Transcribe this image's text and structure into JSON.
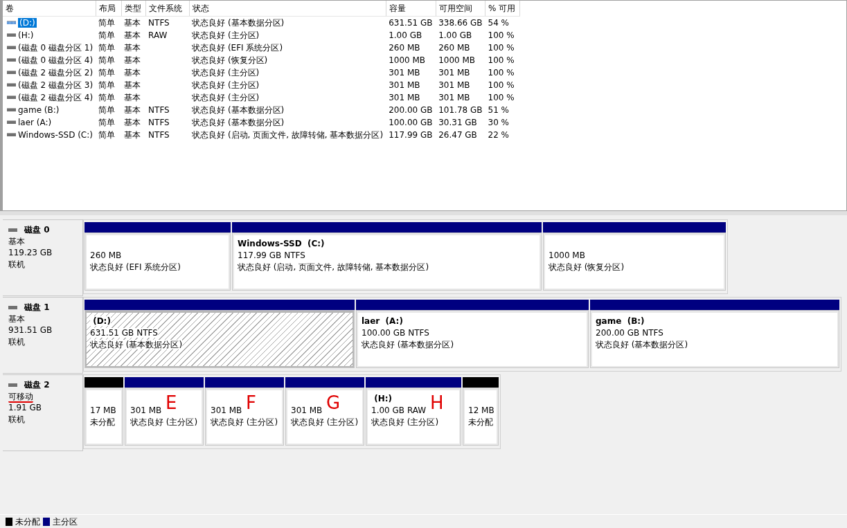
{
  "volume_table": {
    "columns": [
      "卷",
      "布局",
      "类型",
      "文件系统",
      "状态",
      "容量",
      "可用空间",
      "% 可用"
    ],
    "rows": [
      {
        "selected": true,
        "cells": [
          "(D:)",
          "简单",
          "基本",
          "NTFS",
          "状态良好 (基本数据分区)",
          "631.51 GB",
          "338.66 GB",
          "54 %"
        ]
      },
      {
        "selected": false,
        "cells": [
          "(H:)",
          "简单",
          "基本",
          "RAW",
          "状态良好 (主分区)",
          "1.00 GB",
          "1.00 GB",
          "100 %"
        ]
      },
      {
        "selected": false,
        "cells": [
          "(磁盘 0 磁盘分区 1)",
          "简单",
          "基本",
          "",
          "状态良好 (EFI 系统分区)",
          "260 MB",
          "260 MB",
          "100 %"
        ]
      },
      {
        "selected": false,
        "cells": [
          "(磁盘 0 磁盘分区 4)",
          "简单",
          "基本",
          "",
          "状态良好 (恢复分区)",
          "1000 MB",
          "1000 MB",
          "100 %"
        ]
      },
      {
        "selected": false,
        "cells": [
          "(磁盘 2 磁盘分区 2)",
          "简单",
          "基本",
          "",
          "状态良好 (主分区)",
          "301 MB",
          "301 MB",
          "100 %"
        ]
      },
      {
        "selected": false,
        "cells": [
          "(磁盘 2 磁盘分区 3)",
          "简单",
          "基本",
          "",
          "状态良好 (主分区)",
          "301 MB",
          "301 MB",
          "100 %"
        ]
      },
      {
        "selected": false,
        "cells": [
          "(磁盘 2 磁盘分区 4)",
          "简单",
          "基本",
          "",
          "状态良好 (主分区)",
          "301 MB",
          "301 MB",
          "100 %"
        ]
      },
      {
        "selected": false,
        "cells": [
          "game (B:)",
          "简单",
          "基本",
          "NTFS",
          "状态良好 (基本数据分区)",
          "200.00 GB",
          "101.78 GB",
          "51 %"
        ]
      },
      {
        "selected": false,
        "cells": [
          "laer (A:)",
          "简单",
          "基本",
          "NTFS",
          "状态良好 (基本数据分区)",
          "100.00 GB",
          "30.31 GB",
          "30 %"
        ]
      },
      {
        "selected": false,
        "cells": [
          "Windows-SSD (C:)",
          "简单",
          "基本",
          "NTFS",
          "状态良好 (启动, 页面文件, 故障转储, 基本数据分区)",
          "117.99 GB",
          "26.47 GB",
          "22 %"
        ]
      }
    ]
  },
  "disks": [
    {
      "name": "磁盘 0",
      "type": "基本",
      "size": "119.23 GB",
      "status": "联机",
      "type_underlined": false,
      "partitions": [
        {
          "kind": "primary",
          "selected": false,
          "size": "260 MB",
          "status": "状态良好 (EFI 系统分区)"
        },
        {
          "kind": "primary",
          "selected": false,
          "name": "Windows-SSD  (C:)",
          "size": "117.99 GB NTFS",
          "status": "状态良好 (启动, 页面文件, 故障转储, 基本数据分区)"
        },
        {
          "kind": "primary",
          "selected": false,
          "size": "1000 MB",
          "status": "状态良好 (恢复分区)"
        }
      ]
    },
    {
      "name": "磁盘 1",
      "type": "基本",
      "size": "931.51 GB",
      "status": "联机",
      "type_underlined": false,
      "partitions": [
        {
          "kind": "primary",
          "selected": true,
          "name": " (D:)",
          "size": "631.51 GB NTFS",
          "status": "状态良好 (基本数据分区)"
        },
        {
          "kind": "primary",
          "selected": false,
          "name": "laer  (A:)",
          "size": "100.00 GB NTFS",
          "status": "状态良好 (基本数据分区)"
        },
        {
          "kind": "primary",
          "selected": false,
          "name": "game  (B:)",
          "size": "200.00 GB NTFS",
          "status": "状态良好 (基本数据分区)"
        }
      ]
    },
    {
      "name": "磁盘 2",
      "type": "可移动",
      "size": "1.91 GB",
      "status": "联机",
      "type_underlined": true,
      "partitions": [
        {
          "kind": "unallocated",
          "selected": false,
          "size": "17 MB",
          "status": "未分配"
        },
        {
          "kind": "primary",
          "selected": false,
          "size": "301 MB",
          "status": "状态良好 (主分区)",
          "annotation": "E"
        },
        {
          "kind": "primary",
          "selected": false,
          "size": "301 MB",
          "status": "状态良好 (主分区)",
          "annotation": "F"
        },
        {
          "kind": "primary",
          "selected": false,
          "size": "301 MB",
          "status": "状态良好 (主分区)",
          "annotation": "G"
        },
        {
          "kind": "primary",
          "selected": false,
          "name": " (H:)",
          "size": "1.00 GB RAW",
          "status": "状态良好 (主分区)",
          "annotation": "H"
        },
        {
          "kind": "unallocated",
          "selected": false,
          "size": "12 MB",
          "status": "未分配"
        }
      ]
    }
  ],
  "legend": [
    {
      "label": "未分配",
      "color": "#000000"
    },
    {
      "label": "主分区",
      "color": "#000080"
    }
  ]
}
